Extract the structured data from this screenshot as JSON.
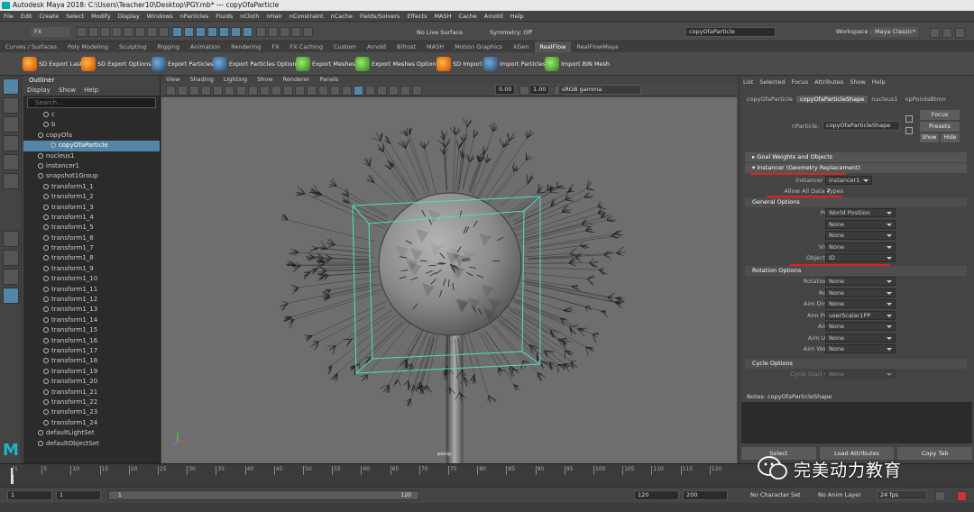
{
  "window": {
    "title": "Autodesk Maya 2018: C:\\Users\\Teacher10\\Desktop\\PGY.mb*  ---  copyOfaParticle"
  },
  "menu": [
    "File",
    "Edit",
    "Create",
    "Select",
    "Modify",
    "Display",
    "Windows",
    "nParticles",
    "Fluids",
    "nCloth",
    "nHair",
    "nConstraint",
    "nCache",
    "Fields/Solvers",
    "Effects",
    "MASH",
    "Cache",
    "Arnold",
    "Help"
  ],
  "status": {
    "mode": "FX",
    "live_surface": "No Live Surface",
    "symmetry": "Symmetry: Off",
    "search_value": "copyOfaParticle",
    "workspace_label": "Workspace :",
    "workspace": "Maya Classic*"
  },
  "shelf_tabs": [
    "Curves / Surfaces",
    "Poly Modeling",
    "Sculpting",
    "Rigging",
    "Animation",
    "Rendering",
    "FX",
    "FX Caching",
    "Custom",
    "Arnold",
    "Bifrost",
    "MASH",
    "Motion Graphics",
    "XGen",
    "RealFlow",
    "RealFlowMaya"
  ],
  "shelf_active": "RealFlow",
  "shelf_buttons": [
    "SD Export Last",
    "SD Export Options",
    "Export Particles",
    "Export Particles Option",
    "Export Meshes",
    "Export Meshes Options",
    "SD Import",
    "Import Particles",
    "Import BIN Mesh"
  ],
  "outliner": {
    "title": "Outliner",
    "menu": [
      "Display",
      "Show",
      "Help"
    ],
    "search_placeholder": "Search...",
    "items": [
      "c",
      "b",
      "copyOfa",
      "copyOfaParticle",
      "nucleus1",
      "instancer1",
      "snapshot1Group",
      "transform1_1",
      "transform1_2",
      "transform1_3",
      "transform1_4",
      "transform1_5",
      "transform1_6",
      "transform1_7",
      "transform1_8",
      "transform1_9",
      "transform1_10",
      "transform1_11",
      "transform1_12",
      "transform1_13",
      "transform1_14",
      "transform1_15",
      "transform1_16",
      "transform1_17",
      "transform1_18",
      "transform1_19",
      "transform1_20",
      "transform1_21",
      "transform1_22",
      "transform1_23",
      "transform1_24",
      "defaultLightSet",
      "defaultObjectSet"
    ]
  },
  "viewport": {
    "menu": [
      "View",
      "Shading",
      "Lighting",
      "Show",
      "Renderer",
      "Panels"
    ],
    "field1": "0.00",
    "field2": "1.00",
    "color_space": "sRGB gamma",
    "camera": "persp"
  },
  "attr_editor": {
    "menu": [
      "List",
      "Selected",
      "Focus",
      "Attributes",
      "Show",
      "Help"
    ],
    "tabs": [
      "copyOfaParticle",
      "copyOfaParticleShape",
      "nucleus1",
      "npPointsBtmn"
    ],
    "active_tab": "copyOfaParticleShape",
    "node_label": "nParticle:",
    "node_value": "copyOfaParticleShape",
    "btn_focus": "Focus",
    "btn_presets": "Presets",
    "btn_show": "Show",
    "btn_hide": "Hide",
    "sec_goal": "Goal Weights and Objects",
    "sec_instancer": "Instancer (Geometry Replacement)",
    "instancer_nodes_label": "Instancer Nodes",
    "instancer_nodes_value": "instancer1",
    "allow_all_label": "Allow All Data Types",
    "allow_all_value": "✓",
    "sec_general": "General Options",
    "general": [
      [
        "Position",
        "World Position"
      ],
      [
        "Scale",
        "None"
      ],
      [
        "Shear",
        "None"
      ],
      [
        "Visibility",
        "None"
      ],
      [
        "Object Index",
        "ID"
      ]
    ],
    "sec_rotation": "Rotation Options",
    "rotation": [
      [
        "Rotation Type",
        "None"
      ],
      [
        "Rotation",
        "None"
      ],
      [
        "Aim Direction",
        "None"
      ],
      [
        "Aim Position",
        "userScalar1PP"
      ],
      [
        "Aim Axis",
        "None"
      ],
      [
        "Aim Up Axis",
        "None"
      ],
      [
        "Aim World Up",
        "None"
      ]
    ],
    "sec_cycle": "Cycle Options",
    "cycle_start": "Cycle Start Object",
    "cycle_start_value": "None",
    "notes_label": "Notes: copyOfaParticleShape",
    "bottom_buttons": [
      "Select",
      "Load Attributes",
      "Copy Tab"
    ]
  },
  "timeline": {
    "ticks": [
      "1",
      "5",
      "10",
      "15",
      "20",
      "25",
      "30",
      "35",
      "40",
      "45",
      "50",
      "55",
      "60",
      "65",
      "70",
      "75",
      "80",
      "85",
      "90",
      "95",
      "100",
      "105",
      "110",
      "115",
      "120"
    ]
  },
  "range": {
    "start": "1",
    "start2": "1",
    "slider_start": "1",
    "slider_end": "120",
    "end": "120",
    "end2": "200",
    "char_set": "No Character Set",
    "anim_layer": "No Anim Layer",
    "fps": "24 fps"
  },
  "watermark": "完美动力教育",
  "colors": {
    "accent": "#5285a6",
    "highlight_red": "#e02020",
    "manip": "#4ee0c0"
  }
}
